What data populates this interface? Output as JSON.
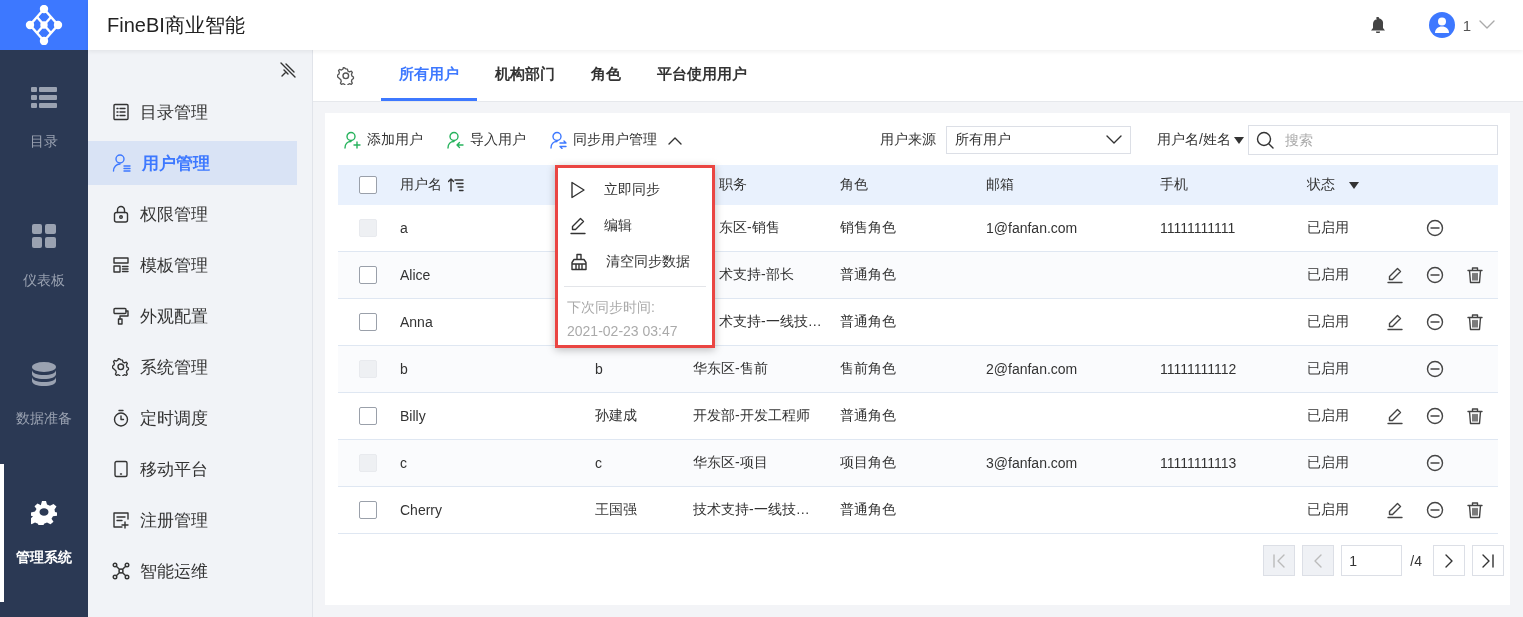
{
  "app": {
    "title": "FineBI商业智能",
    "user": "1"
  },
  "rail": [
    {
      "label": "目录",
      "selected": false
    },
    {
      "label": "仪表板",
      "selected": false
    },
    {
      "label": "数据准备",
      "selected": false
    },
    {
      "label": "管理系统",
      "selected": true
    }
  ],
  "sidebar": {
    "items": [
      {
        "label": "目录管理",
        "selected": false
      },
      {
        "label": "用户管理",
        "selected": true
      },
      {
        "label": "权限管理",
        "selected": false
      },
      {
        "label": "模板管理",
        "selected": false
      },
      {
        "label": "外观配置",
        "selected": false
      },
      {
        "label": "系统管理",
        "selected": false
      },
      {
        "label": "定时调度",
        "selected": false
      },
      {
        "label": "移动平台",
        "selected": false
      },
      {
        "label": "注册管理",
        "selected": false
      },
      {
        "label": "智能运维",
        "selected": false
      }
    ]
  },
  "tabs": [
    {
      "label": "所有用户",
      "selected": true
    },
    {
      "label": "机构部门",
      "selected": false
    },
    {
      "label": "角色",
      "selected": false
    },
    {
      "label": "平台使用用户",
      "selected": false
    }
  ],
  "toolbar": {
    "actions": [
      "添加用户",
      "导入用户"
    ],
    "sync_label": "同步用户管理",
    "sync_expanded": true,
    "source_label": "用户来源",
    "source_value": "所有用户",
    "search_scope": "用户名/姓名",
    "search_placeholder": "搜索"
  },
  "sync_menu": {
    "items": [
      "立即同步",
      "编辑",
      "清空同步数据"
    ],
    "next_sync_label": "下次同步时间:",
    "next_sync_time": "2021-02-23 03:47"
  },
  "table": {
    "header_checked": false,
    "columns": [
      {
        "label": "用户名",
        "kind": "sort"
      },
      {
        "label": "职务",
        "kind": "cut"
      },
      {
        "label": "角色",
        "kind": "plain"
      },
      {
        "label": "邮箱",
        "kind": "plain"
      },
      {
        "label": "手机",
        "kind": "plain"
      },
      {
        "label": "状态",
        "kind": "filter"
      }
    ],
    "rows": [
      {
        "username": "a",
        "dept": "东区-销售",
        "dept_cut": true,
        "role": "销售角色",
        "email": "1@fanfan.com",
        "phone": "11111111111",
        "status": "已启用",
        "checkbox_disabled": true,
        "editable": false
      },
      {
        "username": "Alice",
        "dept": "术支持-部长",
        "dept_cut": true,
        "role": "普通角色",
        "status": "已启用",
        "checkbox_disabled": false,
        "editable": true
      },
      {
        "username": "Anna",
        "dept": "术支持-一线技…",
        "dept_cut": true,
        "role": "普通角色",
        "status": "已启用",
        "checkbox_disabled": false,
        "editable": true
      },
      {
        "username": "b",
        "name": "b",
        "dept": "华东区-售前",
        "dept_cut": false,
        "role": "售前角色",
        "email": "2@fanfan.com",
        "phone": "11111111112",
        "status": "已启用",
        "checkbox_disabled": true,
        "editable": false
      },
      {
        "username": "Billy",
        "name": "孙建成",
        "dept": "开发部-开发工程师",
        "dept_cut": false,
        "role": "普通角色",
        "status": "已启用",
        "checkbox_disabled": false,
        "editable": true
      },
      {
        "username": "c",
        "name": "c",
        "dept": "华东区-项目",
        "dept_cut": false,
        "role": "项目角色",
        "email": "3@fanfan.com",
        "phone": "11111111113",
        "status": "已启用",
        "checkbox_disabled": true,
        "editable": false
      },
      {
        "username": "Cherry",
        "name": "王国强",
        "dept": "技术支持-一线技…",
        "dept_cut": false,
        "role": "普通角色",
        "status": "已启用",
        "checkbox_disabled": false,
        "editable": true
      }
    ]
  },
  "pagination": {
    "page": "1",
    "total": "/4",
    "first_disabled": true,
    "prev_disabled": true
  }
}
